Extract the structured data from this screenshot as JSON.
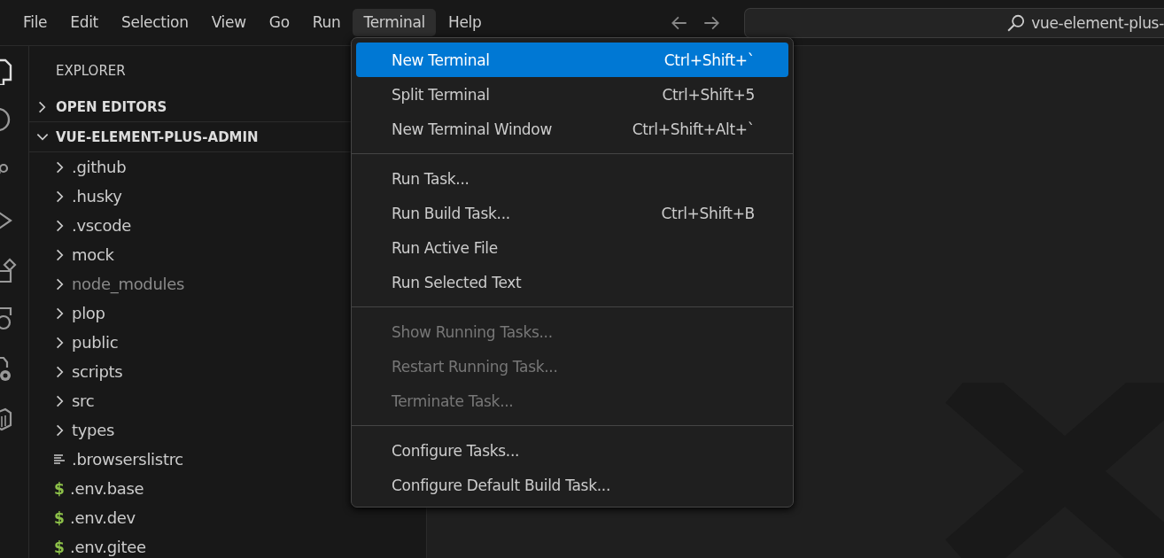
{
  "menubar": {
    "items": [
      {
        "label": "File",
        "selected": false
      },
      {
        "label": "Edit",
        "selected": false
      },
      {
        "label": "Selection",
        "selected": false
      },
      {
        "label": "View",
        "selected": false
      },
      {
        "label": "Go",
        "selected": false
      },
      {
        "label": "Run",
        "selected": false
      },
      {
        "label": "Terminal",
        "selected": true
      },
      {
        "label": "Help",
        "selected": false
      }
    ]
  },
  "search": {
    "value": "vue-element-plus-"
  },
  "sidebar": {
    "title": "EXPLORER",
    "sections": [
      {
        "label": "OPEN EDITORS",
        "expanded": false
      },
      {
        "label": "VUE-ELEMENT-PLUS-ADMIN",
        "expanded": true
      }
    ],
    "items": [
      {
        "kind": "folder",
        "label": ".github",
        "dimmed": false
      },
      {
        "kind": "folder",
        "label": ".husky",
        "dimmed": false
      },
      {
        "kind": "folder",
        "label": ".vscode",
        "dimmed": false
      },
      {
        "kind": "folder",
        "label": "mock",
        "dimmed": false
      },
      {
        "kind": "folder",
        "label": "node_modules",
        "dimmed": true
      },
      {
        "kind": "folder",
        "label": "plop",
        "dimmed": false
      },
      {
        "kind": "folder",
        "label": "public",
        "dimmed": false
      },
      {
        "kind": "folder",
        "label": "scripts",
        "dimmed": false
      },
      {
        "kind": "folder",
        "label": "src",
        "dimmed": false
      },
      {
        "kind": "folder",
        "label": "types",
        "dimmed": false
      },
      {
        "kind": "text",
        "label": ".browserslistrc",
        "dimmed": false
      },
      {
        "kind": "env",
        "icon": "$",
        "label": ".env.base",
        "dimmed": false
      },
      {
        "kind": "env",
        "icon": "$",
        "label": ".env.dev",
        "dimmed": false
      },
      {
        "kind": "env",
        "icon": "$",
        "label": ".env.gitee",
        "dimmed": false
      }
    ]
  },
  "terminal_menu": {
    "items": [
      {
        "kind": "item",
        "label": "New Terminal",
        "shortcut": "Ctrl+Shift+`",
        "selected": true,
        "disabled": false
      },
      {
        "kind": "item",
        "label": "Split Terminal",
        "shortcut": "Ctrl+Shift+5",
        "selected": false,
        "disabled": false
      },
      {
        "kind": "item",
        "label": "New Terminal Window",
        "shortcut": "Ctrl+Shift+Alt+`",
        "selected": false,
        "disabled": false
      },
      {
        "kind": "separator"
      },
      {
        "kind": "item",
        "label": "Run Task...",
        "selected": false,
        "disabled": false
      },
      {
        "kind": "item",
        "label": "Run Build Task...",
        "shortcut": "Ctrl+Shift+B",
        "selected": false,
        "disabled": false
      },
      {
        "kind": "item",
        "label": "Run Active File",
        "selected": false,
        "disabled": false
      },
      {
        "kind": "item",
        "label": "Run Selected Text",
        "selected": false,
        "disabled": false
      },
      {
        "kind": "separator"
      },
      {
        "kind": "item",
        "label": "Show Running Tasks...",
        "selected": false,
        "disabled": true
      },
      {
        "kind": "item",
        "label": "Restart Running Task...",
        "selected": false,
        "disabled": true
      },
      {
        "kind": "item",
        "label": "Terminate Task...",
        "selected": false,
        "disabled": true
      },
      {
        "kind": "separator"
      },
      {
        "kind": "item",
        "label": "Configure Tasks...",
        "selected": false,
        "disabled": false
      },
      {
        "kind": "item",
        "label": "Configure Default Build Task...",
        "selected": false,
        "disabled": false
      }
    ]
  }
}
